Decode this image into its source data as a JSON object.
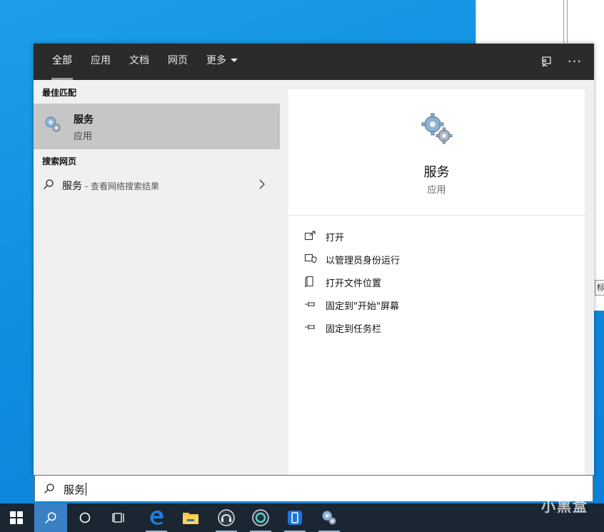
{
  "background_window": {
    "edge_label": "标"
  },
  "tabs": [
    {
      "label": "全部",
      "active": true
    },
    {
      "label": "应用"
    },
    {
      "label": "文档"
    },
    {
      "label": "网页"
    },
    {
      "label": "更多"
    }
  ],
  "toolbar_icons": {
    "feedback": "feedback-icon",
    "more": "more-options-icon",
    "more_text": "···"
  },
  "left": {
    "best_match_title": "最佳匹配",
    "best_match": {
      "name": "服务",
      "type": "应用",
      "icon": "services-gear-icon"
    },
    "web_title": "搜索网页",
    "web_result": {
      "term": "服务",
      "suffix": " - 查看网络搜索结果"
    }
  },
  "detail": {
    "name": "服务",
    "type": "应用",
    "actions": [
      {
        "label": "打开",
        "icon": "open-icon"
      },
      {
        "label": "以管理员身份运行",
        "icon": "admin-shield-icon"
      },
      {
        "label": "打开文件位置",
        "icon": "file-location-icon"
      },
      {
        "label": "固定到\"开始\"屏幕",
        "icon": "pin-icon"
      },
      {
        "label": "固定到任务栏",
        "icon": "pin-icon"
      }
    ]
  },
  "search": {
    "value": "服务"
  },
  "watermark": "小黑盒",
  "colors": {
    "tabbar": "#2b2b2b",
    "best_match_bg": "#c6c6c6",
    "taskbar": "#1b2633",
    "desktop": "#0f8ee0"
  }
}
